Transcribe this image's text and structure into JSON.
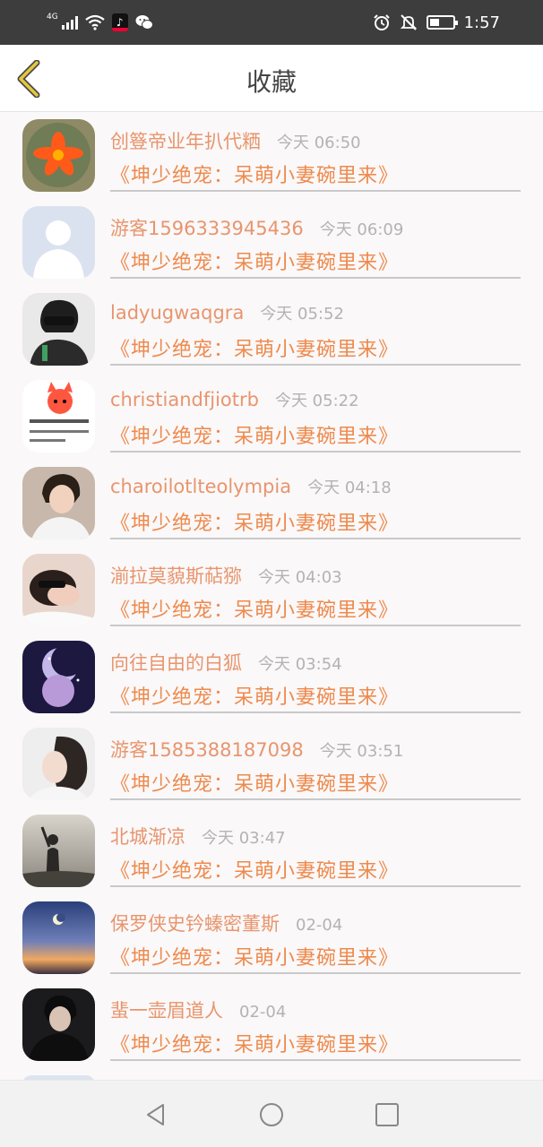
{
  "status_bar": {
    "network": "4G",
    "time": "1:57",
    "icons": [
      "signal-icon",
      "wifi-icon",
      "tiktok-icon",
      "wechat-icon",
      "alarm-icon",
      "mute-icon",
      "battery-icon"
    ]
  },
  "header": {
    "title": "收藏",
    "back_icon": "chevron-left-icon"
  },
  "colors": {
    "accent": "#e8956d",
    "book_title": "#ee8a4d",
    "back_arrow": "#e0c43a",
    "time_text": "#b3b3b3",
    "status_bar_bg": "#3d3d3d"
  },
  "favorites": [
    {
      "name": "创簦帝业年扒代粞",
      "time": "今天 06:50",
      "book": "《坤少绝宠：呆萌小妻碗里来》",
      "avatar": "flower-avatar"
    },
    {
      "name": "游客1596333945436",
      "time": "今天 06:09",
      "book": "《坤少绝宠：呆萌小妻碗里来》",
      "avatar": "default-person-avatar"
    },
    {
      "name": "ladyugwaqgra",
      "time": "今天 05:52",
      "book": "《坤少绝宠：呆萌小妻碗里来》",
      "avatar": "man-sunglasses-avatar"
    },
    {
      "name": "christiandfjiotrb",
      "time": "今天 05:22",
      "book": "《坤少绝宠：呆萌小妻碗里来》",
      "avatar": "cartoon-fox-avatar"
    },
    {
      "name": "charoilotlteolympia",
      "time": "今天 04:18",
      "book": "《坤少绝宠：呆萌小妻碗里来》",
      "avatar": "young-man-avatar"
    },
    {
      "name": "湔拉莫藐斯萜猕",
      "time": "今天 04:03",
      "book": "《坤少绝宠：呆萌小妻碗里来》",
      "avatar": "couple-avatar"
    },
    {
      "name": "向往自由的白狐",
      "time": "今天 03:54",
      "book": "《坤少绝宠：呆萌小妻碗里来》",
      "avatar": "moon-art-avatar"
    },
    {
      "name": "游客1585388187098",
      "time": "今天 03:51",
      "book": "《坤少绝宠：呆萌小妻碗里来》",
      "avatar": "girl-profile-avatar"
    },
    {
      "name": "北城渐凉",
      "time": "今天 03:47",
      "book": "《坤少绝宠：呆萌小妻碗里来》",
      "avatar": "silhouette-avatar"
    },
    {
      "name": "保罗侠史钤螓密董斯",
      "time": "02-04",
      "book": "《坤少绝宠：呆萌小妻碗里来》",
      "avatar": "sunset-sky-avatar"
    },
    {
      "name": "蜚一壶眉道人",
      "time": "02-04",
      "book": "《坤少绝宠：呆萌小妻碗里来》",
      "avatar": "dark-man-avatar"
    }
  ],
  "nav_bar": {
    "icons": [
      "back-triangle-icon",
      "home-circle-icon",
      "recents-square-icon"
    ]
  }
}
